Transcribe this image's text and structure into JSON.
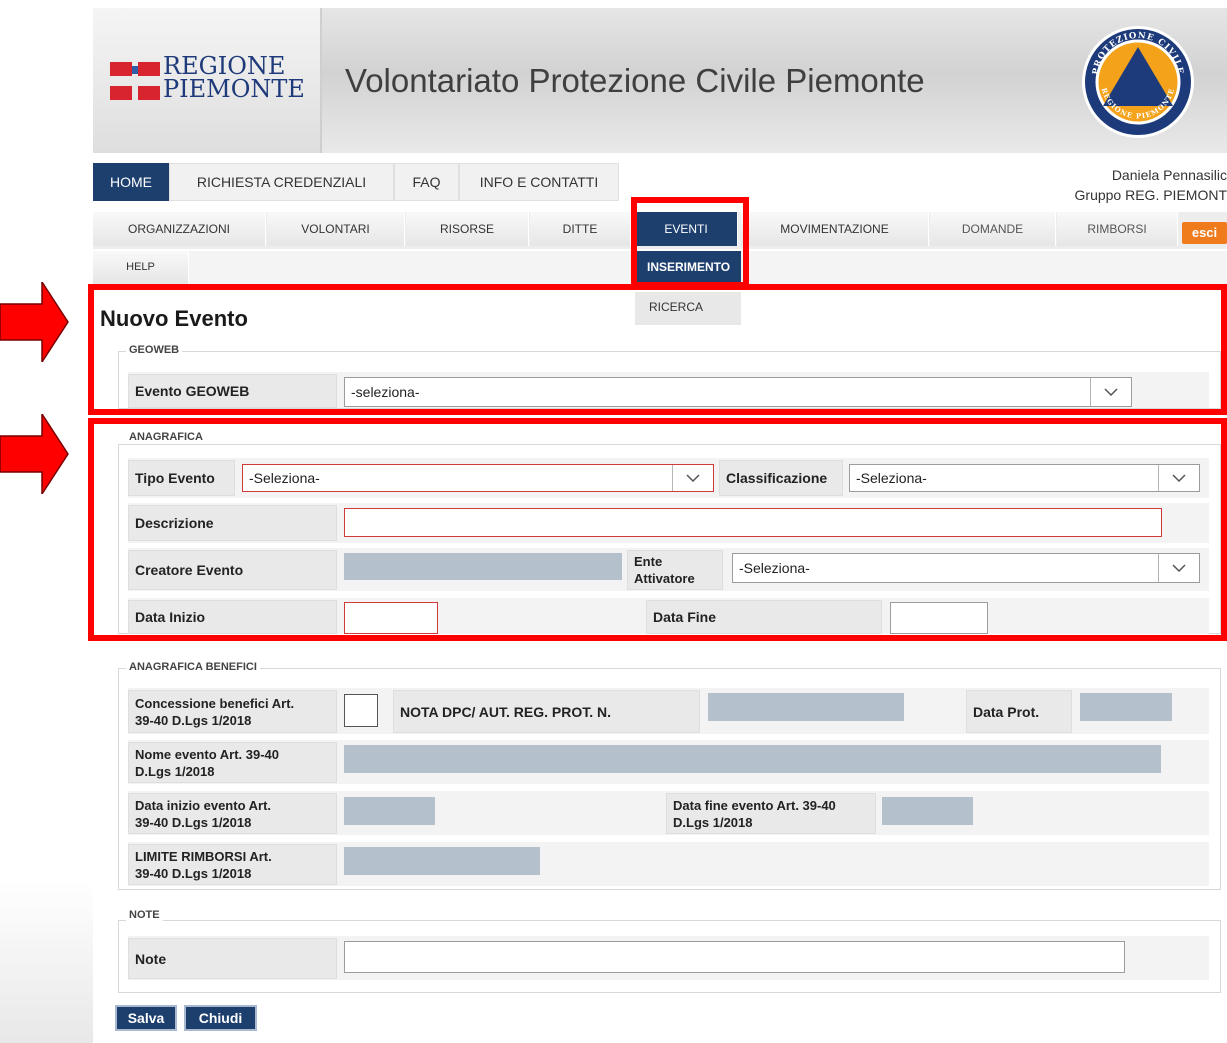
{
  "header": {
    "logo_line1": "REGIONE",
    "logo_line2": "PIEMONTE",
    "site_title": "Volontariato Protezione Civile Piemonte",
    "emblem_top_text": "PROTEZIONE CIVILE",
    "emblem_bottom_text": "REGIONE PIEMONTE"
  },
  "nav_main": {
    "items": [
      {
        "label": "HOME",
        "active": true
      },
      {
        "label": "RICHIESTA CREDENZIALI"
      },
      {
        "label": "FAQ"
      },
      {
        "label": "INFO E CONTATTI"
      }
    ]
  },
  "user": {
    "name": "Daniela Pennasilic",
    "group": "Gruppo REG. PIEMONT"
  },
  "nav_sub": {
    "items": [
      {
        "label": "ORGANIZZAZIONI"
      },
      {
        "label": "VOLONTARI"
      },
      {
        "label": "RISORSE"
      },
      {
        "label": "DITTE"
      },
      {
        "label": "EVENTI",
        "active": true
      },
      {
        "label": "MOVIMENTAZIONE"
      },
      {
        "label": "DOMANDE"
      },
      {
        "label": "RIMBORSI"
      }
    ],
    "logout_label": "esci",
    "help_label": "HELP",
    "dropdown": [
      {
        "label": "INSERIMENTO",
        "active": true
      },
      {
        "label": "RICERCA"
      }
    ]
  },
  "page": {
    "title": "Nuovo Evento"
  },
  "geoweb": {
    "legend": "GEOWEB",
    "evento_label": "Evento GEOWEB",
    "evento_value": "-seleziona-"
  },
  "anagrafica": {
    "legend": "ANAGRAFICA",
    "tipo_label": "Tipo Evento",
    "tipo_value": "-Seleziona-",
    "classificazione_label": "Classificazione",
    "classificazione_value": "-Seleziona-",
    "descrizione_label": "Descrizione",
    "creatore_label": "Creatore Evento",
    "ente_label_1": "Ente",
    "ente_label_2": "Attivatore",
    "ente_value": "-Seleziona-",
    "data_inizio_label": "Data Inizio",
    "data_fine_label": "Data Fine"
  },
  "benefici": {
    "legend": "ANAGRAFICA BENEFICI",
    "concessione_label_1": "Concessione benefici Art.",
    "concessione_label_2": "39-40 D.Lgs 1/2018",
    "nota_label": "NOTA DPC/ AUT. REG. PROT. N.",
    "data_prot_label": "Data Prot.",
    "nome_label_1": "Nome evento Art. 39-40",
    "nome_label_2": "D.Lgs 1/2018",
    "data_inizio_label_1": "Data inizio evento Art.",
    "data_inizio_label_2": "39-40 D.Lgs 1/2018",
    "data_fine_label_1": "Data fine evento Art. 39-40",
    "data_fine_label_2": "D.Lgs 1/2018",
    "limite_label_1": "LIMITE RIMBORSI Art.",
    "limite_label_2": "39-40 D.Lgs 1/2018"
  },
  "note": {
    "legend": "NOTE",
    "note_label": "Note"
  },
  "actions": {
    "save_label": "Salva",
    "close_label": "Chiudi"
  },
  "colors": {
    "highlight": "#ff0000",
    "nav_active": "#1d3f6e",
    "logout_button": "#f07b1d",
    "readonly_field": "#b4c0cc"
  }
}
